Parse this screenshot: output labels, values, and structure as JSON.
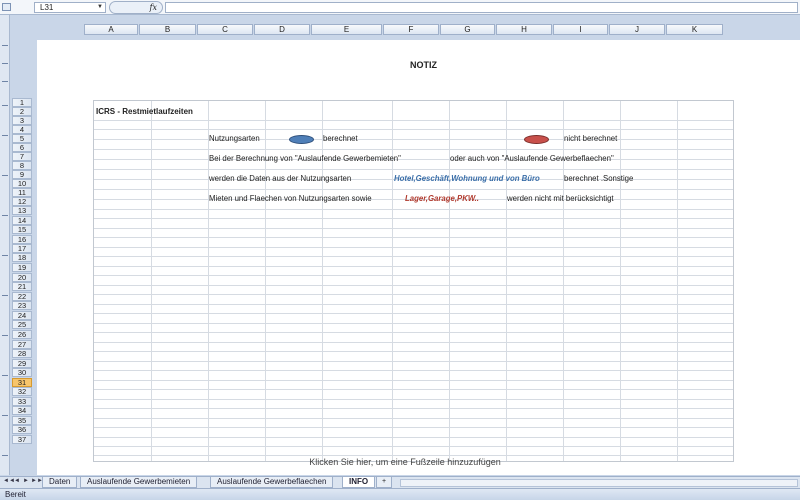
{
  "formula_bar": {
    "name_box": "L31",
    "fx_label": "fx",
    "formula": ""
  },
  "columns": [
    "A",
    "B",
    "C",
    "D",
    "E",
    "F",
    "G",
    "H",
    "I",
    "J",
    "K"
  ],
  "rows": [
    "1",
    "2",
    "3",
    "4",
    "5",
    "6",
    "7",
    "8",
    "9",
    "10",
    "11",
    "12",
    "13",
    "14",
    "15",
    "16",
    "17",
    "18",
    "19",
    "20",
    "21",
    "22",
    "23",
    "24",
    "25",
    "26",
    "27",
    "28",
    "29",
    "30",
    "31",
    "32",
    "33",
    "34",
    "35",
    "36",
    "37"
  ],
  "selected_row": "31",
  "page": {
    "header_title": "NOTIZ",
    "sheet_title": "ICRS - Restmietlaufzeiten",
    "legend": {
      "label": "Nutzungsarten",
      "calculated": "berechnet",
      "not_calculated": "nicht berechnet",
      "calculated_color": "#4f7fb8",
      "not_calculated_color": "#c8504b"
    },
    "line1_a": "Bei der Berechnung von \"Auslaufende Gewerbemieten\"",
    "line1_b": "oder auch von \"Auslaufende Gewerbeflaechen\"",
    "line2_a": "werden die Daten aus der Nutzungsarten",
    "line2_highlight": "Hotel,Geschäft,Wohnung und von Büro",
    "line2_b": "berechnet .Sonstige",
    "line3_a": "Mieten und Flaechen von Nutzungsarten sowie",
    "line3_highlight": "Lager,Garage,PKW..",
    "line3_b": "werden nicht mit berücksichtigt",
    "footer_hint": "Klicken Sie hier, um eine Fußzeile hinzuzufügen"
  },
  "tabs": {
    "nav": [
      "◄◄",
      "◄",
      "►",
      "►►"
    ],
    "sheets": [
      "Daten",
      "Auslaufende Gewerbemieten",
      "Auslaufende Gewerbeflaechen",
      "INFO"
    ],
    "active": "INFO",
    "add_icon": "+"
  },
  "status": {
    "text": "Bereit"
  }
}
